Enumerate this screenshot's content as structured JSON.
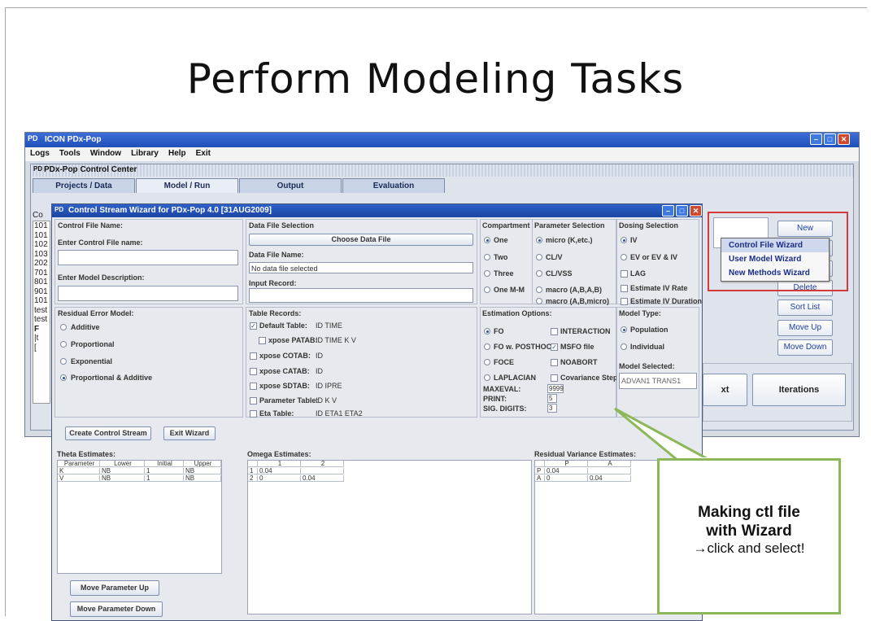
{
  "slide": {
    "title": "Perform Modeling Tasks"
  },
  "app": {
    "title": "ICON PDx-Pop",
    "logo": "PD",
    "menu": [
      "Logs",
      "Tools",
      "Window",
      "Library",
      "Help",
      "Exit"
    ],
    "control_center_title": "PDx-Pop Control Center",
    "tabs": [
      "Projects / Data",
      "Model / Run",
      "Output",
      "Evaluation"
    ],
    "active_tab": "Model / Run",
    "left_col_header": "Co",
    "left_list": [
      "101",
      "101",
      "102",
      "103",
      "202",
      "701",
      "801",
      "901",
      "101",
      "test",
      "test",
      "F",
      "|t",
      "["
    ],
    "buttons": {
      "new": "New",
      "delete": "Delete",
      "sort_list": "Sort List",
      "move_up": "Move Up",
      "move_down": "Move Down",
      "next": "xt",
      "iterations": "Iterations"
    },
    "popup_menu": [
      "Control File Wizard",
      "User Model Wizard",
      "New Methods Wizard"
    ],
    "popup_selected": "Control File Wizard"
  },
  "wizard": {
    "title": "Control Stream Wizard for PDx-Pop 4.0 [31AUG2009]",
    "control_file": {
      "header": "Control File Name:",
      "enter_name_label": "Enter Control File name:",
      "name_value": "",
      "model_desc_label": "Enter Model Description:",
      "model_desc_value": ""
    },
    "data_file": {
      "header": "Data File Selection",
      "choose_button": "Choose Data File",
      "data_file_name_label": "Data File Name:",
      "data_file_value": "No data file selected",
      "input_record_label": "Input Record:"
    },
    "compartments": {
      "header": "Compartment S",
      "options": [
        "One",
        "Two",
        "Three",
        "One M-M"
      ],
      "selected": "One"
    },
    "parameter_selection": {
      "header": "Parameter Selection",
      "options": [
        "micro (K,etc.)",
        "CL/V",
        "CL/VSS",
        "macro (A,B,A,B)",
        "macro (A,B,micro)"
      ],
      "selected": "micro (K,etc.)"
    },
    "dosing": {
      "header": "Dosing Selection",
      "options": [
        "IV",
        "EV or EV & IV"
      ],
      "selected": "IV",
      "checks": [
        "LAG",
        "Estimate IV Rate",
        "Estimate IV Duration"
      ]
    },
    "residual_error": {
      "header": "Residual Error Model:",
      "options": [
        "Additive",
        "Proportional",
        "Exponential",
        "Proportional & Additive"
      ],
      "selected": "Proportional & Additive"
    },
    "table_records": {
      "header": "Table Records:",
      "rows": [
        {
          "label": "Default Table:",
          "value": "ID TIME",
          "checked": true
        },
        {
          "label": "xpose PATAB:",
          "value": "ID TIME K V",
          "checked": false
        },
        {
          "label": "xpose COTAB:",
          "value": "ID",
          "checked": false
        },
        {
          "label": "xpose CATAB:",
          "value": "ID",
          "checked": false
        },
        {
          "label": "xpose SDTAB:",
          "value": "ID IPRE",
          "checked": false
        },
        {
          "label": "Parameter Table:",
          "value": "ID K V",
          "checked": false
        },
        {
          "label": "Eta Table:",
          "value": "ID ETA1 ETA2",
          "checked": false
        }
      ]
    },
    "estimation": {
      "header": "Estimation Options:",
      "methods": [
        "FO",
        "FO w. POSTHOC",
        "FOCE",
        "LAPLACIAN"
      ],
      "selected": "FO",
      "checks": [
        {
          "label": "INTERACTION",
          "checked": false
        },
        {
          "label": "MSFO file",
          "checked": true
        },
        {
          "label": "NOABORT",
          "checked": false
        },
        {
          "label": "Covariance Step",
          "checked": false
        }
      ],
      "maxeval_label": "MAXEVAL:",
      "maxeval": "9999",
      "print_label": "PRINT:",
      "print": "5",
      "sig_label": "SIG. DIGITS:",
      "sig": "3"
    },
    "model_type": {
      "header": "Model Type:",
      "options": [
        "Population",
        "Individual"
      ],
      "selected": "Population",
      "selected_label": "Model Selected:",
      "selected_value": "ADVAN1 TRANS1"
    },
    "buttons": {
      "create": "Create Control Stream",
      "exit": "Exit Wizard",
      "move_param_up": "Move Parameter Up",
      "move_param_down": "Move Parameter Down"
    },
    "theta": {
      "header": "Theta Estimates:",
      "columns": [
        "Parameter",
        "Lower",
        "Initial",
        "Upper"
      ],
      "rows": [
        [
          "K",
          "NB",
          "1",
          "NB"
        ],
        [
          "V",
          "NB",
          "1",
          "NB"
        ]
      ]
    },
    "omega": {
      "header": "Omega Estimates:",
      "columns": [
        "",
        "1",
        "2"
      ],
      "rows": [
        [
          "1",
          "0.04",
          ""
        ],
        [
          "2",
          "0",
          "0.04"
        ]
      ]
    },
    "residual_var": {
      "header": "Residual Variance Estimates:",
      "columns": [
        "",
        "P",
        "A"
      ],
      "rows": [
        [
          "P",
          "0.04",
          ""
        ],
        [
          "A",
          "0",
          "0.04"
        ]
      ]
    }
  },
  "callout": {
    "line1": "Making ctl file",
    "line2": "with Wizard",
    "line3": "→click and select!"
  },
  "colors": {
    "titlebar": "#2e60c9",
    "highlight_border": "#d43a3a",
    "callout_border": "#8db85a",
    "link_text": "#1b2e8a"
  }
}
